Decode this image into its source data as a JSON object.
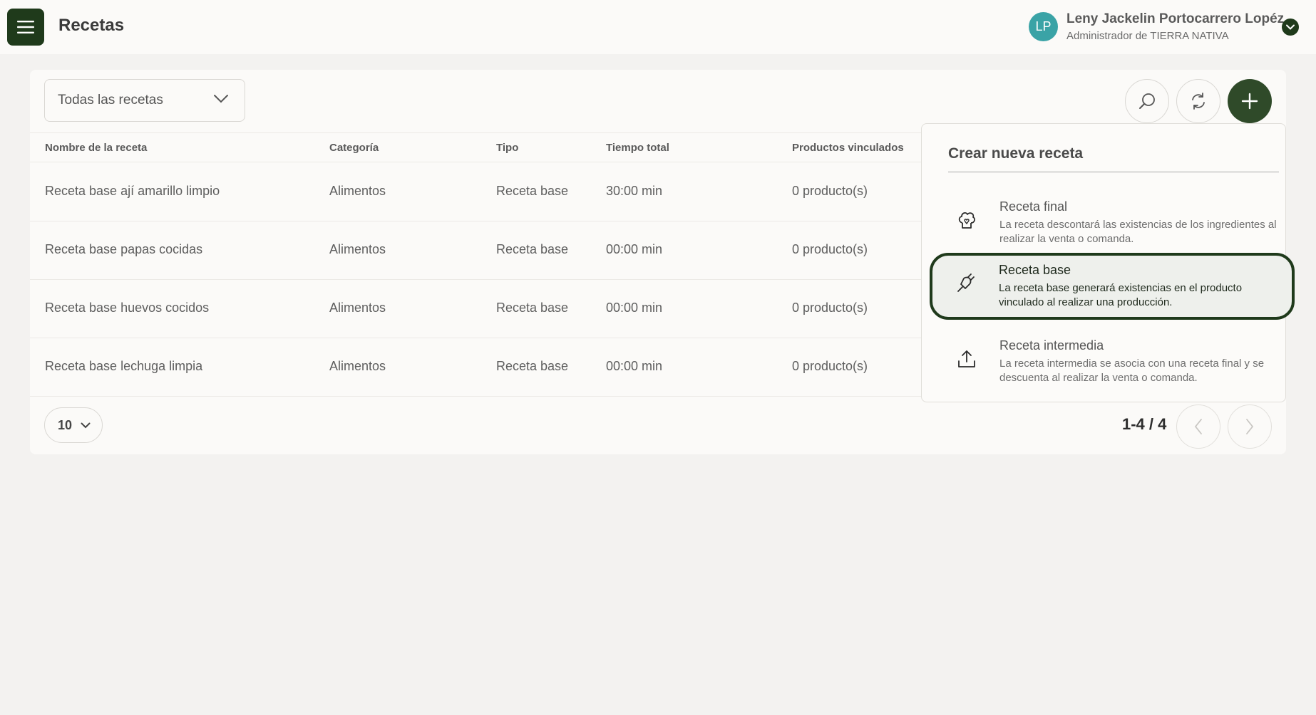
{
  "header": {
    "title": "Recetas",
    "user": {
      "initials": "LP",
      "name": "Leny Jackelin Portocarrero Lopéz",
      "role": "Administrador de TIERRA NATIVA"
    }
  },
  "toolbar": {
    "filter_value": "Todas las recetas"
  },
  "table": {
    "columns": [
      "Nombre de la receta",
      "Categoría",
      "Tipo",
      "Tiempo total",
      "Productos vinculados"
    ],
    "rows": [
      [
        "Receta base ají amarillo limpio",
        "Alimentos",
        "Receta base",
        "30:00 min",
        "0 producto(s)"
      ],
      [
        "Receta base papas cocidas",
        "Alimentos",
        "Receta base",
        "00:00 min",
        "0 producto(s)"
      ],
      [
        "Receta base huevos cocidos",
        "Alimentos",
        "Receta base",
        "00:00 min",
        "0 producto(s)"
      ],
      [
        "Receta base lechuga limpia",
        "Alimentos",
        "Receta base",
        "00:00 min",
        "0 producto(s)"
      ]
    ]
  },
  "pagination": {
    "page_size": "10",
    "range": "1-4 / 4"
  },
  "create_menu": {
    "title": "Crear nueva receta",
    "options": [
      {
        "title": "Receta final",
        "description": "La receta descontará las existencias de los ingredientes al realizar la venta o comanda.",
        "icon": "chef-hat-icon"
      },
      {
        "title": "Receta base",
        "description": "La receta base generará existencias en el producto vinculado al realizar una producción.",
        "icon": "plug-icon"
      },
      {
        "title": "Receta intermedia",
        "description": "La receta intermedia se asocia con una receta final y se descuenta al realizar la venta o comanda.",
        "icon": "upload-icon"
      }
    ]
  },
  "colors": {
    "brand": "#1f3a1b",
    "add_button": "#2f4a29",
    "avatar": "#3aa3a6"
  }
}
